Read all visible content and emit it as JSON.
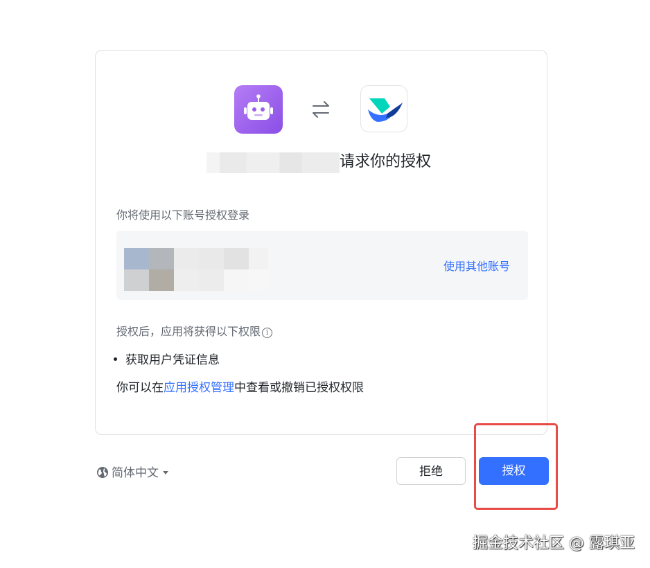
{
  "auth": {
    "request_title": "请求你的授权",
    "account_label": "你将使用以下账号授权登录",
    "other_account_link": "使用其他账号",
    "permissions_label": "授权后，应用将获得以下权限",
    "permissions": [
      "获取用户凭证信息"
    ],
    "manage_prefix": "你可以在",
    "manage_link": "应用授权管理",
    "manage_suffix": "中查看或撤销已授权权限"
  },
  "icons": {
    "app_icon": "robot-icon",
    "swap_icon": "swap-arrows-icon",
    "target_icon": "lark-logo-icon",
    "info_icon": "info-icon",
    "language_icon": "globe-icon"
  },
  "footer": {
    "language": "简体中文",
    "reject_button": "拒绝",
    "authorize_button": "授权"
  },
  "watermark": "掘金技术社区 @ 露琪亚",
  "colors": {
    "accent": "#3370ff",
    "highlight": "#e84a46",
    "app_icon_purple": "#9b5ff0"
  }
}
